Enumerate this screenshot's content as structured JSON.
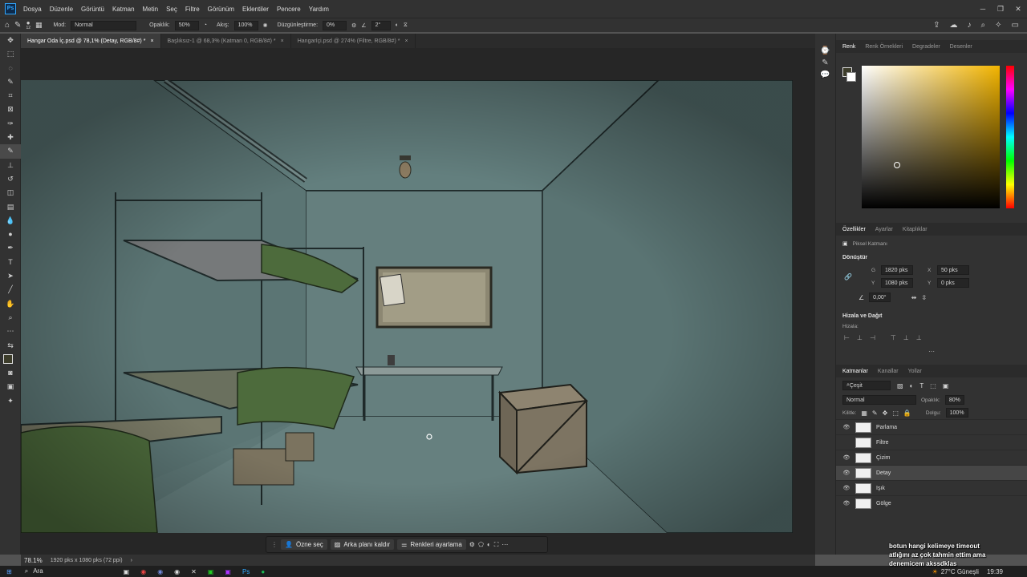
{
  "menubar": {
    "logo": "Ps",
    "items": [
      "Dosya",
      "Düzenle",
      "Görüntü",
      "Katman",
      "Metin",
      "Seç",
      "Filtre",
      "Görünüm",
      "Eklentiler",
      "Pencere",
      "Yardım"
    ],
    "window_controls": [
      "─",
      "❐",
      "✕"
    ]
  },
  "options": {
    "brush_size": "12",
    "mode_label": "Mod:",
    "mode_value": "Normal",
    "opacity_label": "Opaklık:",
    "opacity_value": "50%",
    "flow_label": "Akış:",
    "flow_value": "100%",
    "smoothing_label": "Düzgünleştirme:",
    "smoothing_value": "0%",
    "angle_value": "2°"
  },
  "tabs": [
    {
      "label": "Hangar Oda İç.psd @ 78,1% (Detay, RGB/8#) *",
      "active": true
    },
    {
      "label": "Başlıksız-1 @ 68,3% (Katman 0, RGB/8#) *",
      "active": false
    },
    {
      "label": "HangarIçi.psd @ 274% (Filtre, RGB/8#) *",
      "active": false
    }
  ],
  "contextbar": {
    "subject": "Özne seç",
    "remove_bg": "Arka planı kaldır",
    "adjust_colors": "Renkleri ayarlama"
  },
  "status": {
    "zoom": "78.1%",
    "doc_info": "1920 pks x 1080 pks (72 ppi)"
  },
  "color_panel": {
    "tabs": [
      "Renk",
      "Renk Örnekleri",
      "Degradeler",
      "Desenler"
    ]
  },
  "properties": {
    "tabs": [
      "Özellikler",
      "Ayarlar",
      "Kitaplıklar"
    ],
    "kind": "Piksel Katmanı",
    "transform_title": "Dönüştür",
    "w_label": "G",
    "w_value": "1820 pks",
    "x_label": "X",
    "x_value": "50 pks",
    "h_label": "Y",
    "h_value": "1080 pks",
    "y_label": "Y",
    "y_value": "0 pks",
    "angle": "0,00°",
    "align_title": "Hizala ve Dağıt",
    "align_label": "Hizala:"
  },
  "layers_panel": {
    "tabs": [
      "Katmanlar",
      "Kanallar",
      "Yollar"
    ],
    "filter_label": "Çeşit",
    "blend_mode": "Normal",
    "opacity_label": "Opaklık:",
    "opacity_value": "80%",
    "lock_label": "Kilitle:",
    "fill_label": "Dolgu:",
    "fill_value": "100%",
    "layers": [
      {
        "name": "Parlama",
        "visible": true
      },
      {
        "name": "Filtre",
        "visible": false
      },
      {
        "name": "Çizim",
        "visible": true
      },
      {
        "name": "Detay",
        "visible": true,
        "selected": true
      },
      {
        "name": "Işık",
        "visible": true
      },
      {
        "name": "Gölge",
        "visible": true
      }
    ]
  },
  "taskbar": {
    "search": "Ara",
    "weather": "27°C Güneşli",
    "time": "19:39"
  },
  "overlay": {
    "line1": "botun hangi kelimeye timeout",
    "line2": "atlığını az çok tahmin ettim ama",
    "line3": "denemicem akssdklas"
  },
  "colors": {
    "wall": "#5f7b7a",
    "accent": "#31a8ff"
  }
}
